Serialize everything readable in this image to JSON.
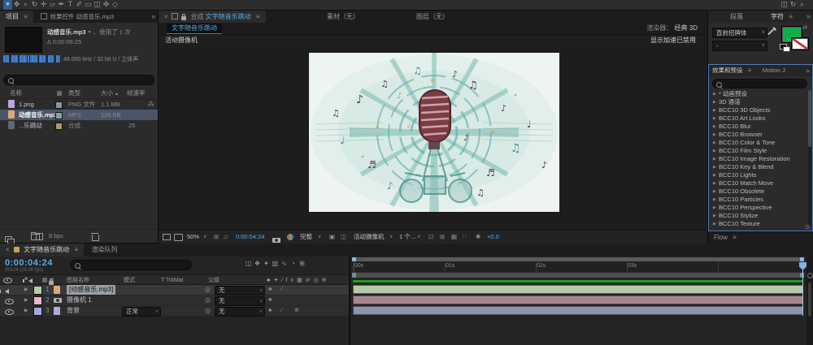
{
  "icons": {
    "menu": "≡",
    "overflow": "»",
    "chevron": "∨",
    "dropdown": "▼",
    "sort_up": "▲",
    "close": "×",
    "arrow": "▶",
    "link": "◎",
    "delta": "Δ",
    "used_badge": "⁂",
    "swap": "⇄",
    "gear": "✱",
    "plus_circle": "⊕"
  },
  "top_toolbar": {
    "tools": [
      {
        "name": "selection-tool",
        "glyph": "⌖",
        "active": true
      },
      {
        "name": "hand-tool",
        "glyph": "✥"
      },
      {
        "name": "zoom-tool",
        "glyph": "⌕"
      },
      {
        "name": "orbit-camera-tool",
        "glyph": "↻"
      },
      {
        "name": "pan-behind-tool",
        "glyph": "✛"
      },
      {
        "name": "mask-shape-tool",
        "glyph": "▱"
      },
      {
        "name": "pen-tool",
        "glyph": "✒"
      },
      {
        "name": "type-tool",
        "glyph": "T"
      },
      {
        "name": "brush-tool",
        "glyph": "✐"
      },
      {
        "name": "clone-stamp-tool",
        "glyph": "▭"
      },
      {
        "name": "eraser-tool",
        "glyph": "◫"
      },
      {
        "name": "roto-brush-tool",
        "glyph": "✜"
      },
      {
        "name": "puppet-pin-tool",
        "glyph": "◇"
      }
    ],
    "right_tools": [
      {
        "name": "workspace-icon",
        "glyph": "◫"
      },
      {
        "name": "sync-settings-icon",
        "glyph": "↻"
      },
      {
        "name": "search-icon",
        "glyph": "⌕"
      }
    ]
  },
  "project_panel": {
    "tab_project": "项目",
    "tab_effect_controls": "效果控件 动感音乐.mp3",
    "preview": {
      "name": "动感音乐.mp3",
      "usage": "、使用了 1 次",
      "duration": "0:00:06:25",
      "audio_info": "48.000 kHz / 32 bit U / 立体声"
    },
    "columns": {
      "name": "名称",
      "type": "类型",
      "size": "大小",
      "fps": "帧速率"
    },
    "rows": [
      {
        "name": "1.png",
        "type": "PNG 文件",
        "size": "1.1 MB",
        "fps": "",
        "icon": "png",
        "tag": "#8a93a6",
        "selected": false,
        "badge": true
      },
      {
        "name": "动感音乐.mp3",
        "type": "MP3",
        "size": "126 KB",
        "fps": "",
        "icon": "mp3",
        "tag": "#7fa8a0",
        "selected": true,
        "badge": false
      },
      {
        "name": "...乐跳动",
        "type": "合成",
        "size": "",
        "fps": "25",
        "icon": "comp",
        "tag": "#b09868",
        "selected": false,
        "badge": false
      }
    ],
    "footer_bit_depth": "8 bpc"
  },
  "comp_panel": {
    "tab_prefix": "合成",
    "tab_name": "文字随音乐跳动",
    "tab_footage": "素材（无）",
    "tab_layer": "图层（无）",
    "breadcrumb": "文字随音乐跳动",
    "renderer_label": "渲染器：",
    "renderer_value": "经典 3D",
    "camera_label": "活动摄像机",
    "accel_warning": "显示加速已禁用",
    "toolbar": {
      "zoom": "50%",
      "timecode": "0:00:04:24",
      "resolution": "完整",
      "camera": "活动摄像机",
      "views": "1 个…",
      "exposure": "+0.0"
    }
  },
  "character_panel": {
    "tab_paragraph": "段落",
    "tab_character": "字符",
    "font_family": "直前招牌体",
    "font_style": "-",
    "fill_color": "#0fae4d"
  },
  "effects_panel": {
    "tab_effects": "效果和预设",
    "tab_motion": "Motion 2",
    "items": [
      "* 动画预设",
      "3D 通道",
      "BCC10 3D Objects",
      "BCC10 Art Looks",
      "BCC10 Blur",
      "BCC10 Browser",
      "BCC10 Color & Tone",
      "BCC10 Film Style",
      "BCC10 Image Restoration",
      "BCC10 Key & Blend",
      "BCC10 Lights",
      "BCC10 Match Move",
      "BCC10 Obsolete",
      "BCC10 Particles",
      "BCC10 Perspective",
      "BCC10 Stylize",
      "BCC10 Texture"
    ]
  },
  "flow_panel": {
    "tab": "Flow"
  },
  "timeline": {
    "tab_name": "文字随音乐跳动",
    "tab_render_queue": "渲染队列",
    "timecode": "0:00:04:24",
    "frame_info": "00124 (25.00 fps)",
    "header_switches": [
      "♣",
      "✦",
      "∕",
      "fx",
      "▦",
      "⊘",
      "◎",
      "⊕"
    ],
    "header_tool_icons": [
      {
        "name": "comp-mini-flowchart-icon",
        "glyph": "◫"
      },
      {
        "name": "live-update-icon",
        "glyph": "❖"
      },
      {
        "name": "draft-3d-icon",
        "glyph": "✦"
      },
      {
        "name": "hide-shy-layers-icon",
        "glyph": "▥"
      },
      {
        "name": "frame-blending-icon",
        "glyph": "∿"
      },
      {
        "name": "motion-blur-icon",
        "glyph": "◔"
      },
      {
        "name": "graph-editor-icon",
        "glyph": "⊞"
      }
    ],
    "columns": {
      "layer_name": "图层名称",
      "mode": "模式",
      "trkmat": "T TrkMat",
      "parent": "父级",
      "hash": "#"
    },
    "layers": [
      {
        "num": "1",
        "name": "[动感音乐.mp3]",
        "chip": "#b3d1a5",
        "bar": "#b6c9ab",
        "mode": "",
        "parent": "无",
        "av": "speaker",
        "src": "audio",
        "selected": true,
        "switches": [
          "♣",
          "∕"
        ]
      },
      {
        "num": "2",
        "name": "摄像机 1",
        "chip": "#eab6c8",
        "bar": "#a5888f",
        "mode": "",
        "parent": "无",
        "av": "eye",
        "src": "cam",
        "selected": false,
        "switches": [
          "♣"
        ]
      },
      {
        "num": "3",
        "name": "背景",
        "chip": "#a3aadd",
        "bar": "#8e93ae",
        "mode": "正常",
        "parent": "无",
        "av": "eye",
        "src": "file",
        "selected": false,
        "switches": [
          "♣",
          "∕",
          "⊕"
        ]
      }
    ],
    "ruler": [
      "00s",
      "01s",
      "02s",
      "03s"
    ],
    "render_bar_color": "#1aa11a"
  }
}
